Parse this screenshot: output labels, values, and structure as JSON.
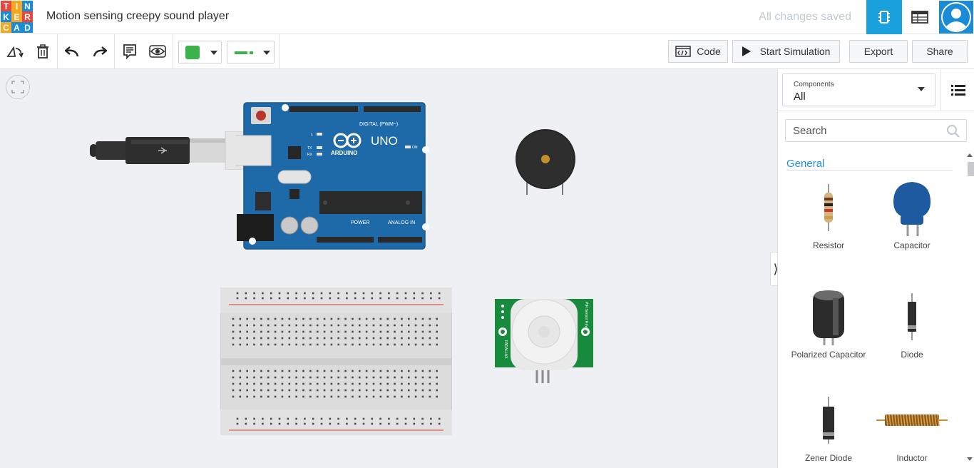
{
  "app": {
    "logo_letters": [
      "T",
      "I",
      "N",
      "K",
      "E",
      "R",
      "C",
      "A",
      "D"
    ],
    "logo_colors": [
      "#e8473a",
      "#f5a623",
      "#1a8bd6",
      "#1a8bd6",
      "#f5a623",
      "#e8473a",
      "#f5a623",
      "#1a8bd6",
      "#1a8bd6"
    ],
    "project_title": "Motion sensing creepy sound player",
    "save_status": "All changes saved"
  },
  "toolbar": {
    "fill_color": "#3cb34a",
    "wire_color": "#3cb34a",
    "code_label": "Code",
    "simulate_label": "Start Simulation",
    "export_label": "Export",
    "share_label": "Share"
  },
  "panel": {
    "select_label": "Components",
    "select_value": "All",
    "search_placeholder": "Search",
    "category": "General",
    "components": [
      {
        "name": "Resistor",
        "icon": "resistor-icon"
      },
      {
        "name": "Capacitor",
        "icon": "capacitor-icon"
      },
      {
        "name": "Polarized Capacitor",
        "icon": "polarized-capacitor-icon"
      },
      {
        "name": "Diode",
        "icon": "diode-icon"
      },
      {
        "name": "Zener Diode",
        "icon": "zener-diode-icon"
      },
      {
        "name": "Inductor",
        "icon": "inductor-icon"
      }
    ]
  },
  "canvas": {
    "arduino": {
      "brand": "ARDUINO",
      "model": "UNO",
      "digital_label": "DIGITAL (PWM~)",
      "power_label": "POWER",
      "analog_label": "ANALOG IN",
      "on_label": "ON",
      "tx_label": "TX",
      "rx_label": "RX",
      "l_label": "L"
    },
    "pir_sensor": {
      "side_label_left": "PARALLAX",
      "side_label_right": "PIR Sensor Rev B"
    }
  },
  "colors": {
    "accent": "#1aa0dc",
    "arduino_blue": "#1e6aa8",
    "pir_green": "#178a3d"
  }
}
